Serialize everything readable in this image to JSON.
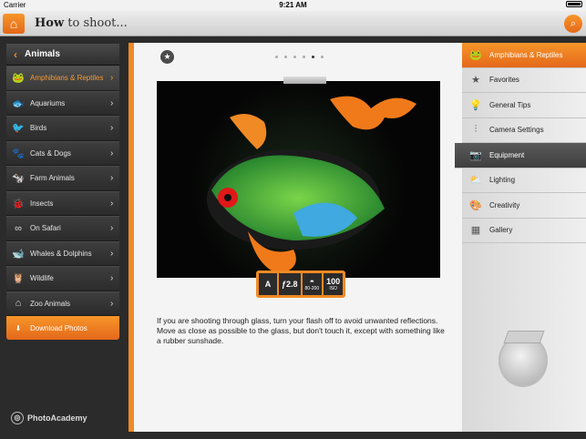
{
  "status_bar": {
    "carrier": "Carrier",
    "time": "9:21 AM",
    "battery_level": 1.0
  },
  "header": {
    "title_bold": "How",
    "title_rest": " to shoot...",
    "home_icon": "home-icon",
    "search_icon": "search-icon"
  },
  "sidebar": {
    "title": "Animals",
    "items": [
      {
        "label": "Amphibians & Reptiles",
        "icon": "frog-icon",
        "active": true
      },
      {
        "label": "Aquariums",
        "icon": "fish-icon"
      },
      {
        "label": "Birds",
        "icon": "bird-icon"
      },
      {
        "label": "Cats & Dogs",
        "icon": "paw-icon"
      },
      {
        "label": "Farm Animals",
        "icon": "cow-icon"
      },
      {
        "label": "Insects",
        "icon": "bug-icon"
      },
      {
        "label": "On Safari",
        "icon": "binoculars-icon"
      },
      {
        "label": "Whales & Dolphins",
        "icon": "whale-icon"
      },
      {
        "label": "Wildlife",
        "icon": "owl-icon"
      },
      {
        "label": "Zoo Animals",
        "icon": "zoo-icon"
      }
    ],
    "download_label": "Download Photos"
  },
  "brand": {
    "name": "PhotoAcademy"
  },
  "content": {
    "page_dots": 6,
    "active_dot": 5,
    "exif": {
      "mode": "A",
      "aperture": "ƒ2.8",
      "iso_range": "80-200",
      "iso": "100",
      "iso_label": "ISO"
    },
    "tip": "If you are shooting through glass, turn your flash off to avoid unwanted reflections. Move as close as possible to the glass, but don't touch it, except with something like a rubber sunshade."
  },
  "rightbar": {
    "items": [
      {
        "label": "Amphibians & Reptiles",
        "icon": "frog-icon",
        "style": "top"
      },
      {
        "label": "Favorites",
        "icon": "star-icon"
      },
      {
        "label": "General Tips",
        "icon": "lightbulb-icon"
      },
      {
        "label": "Camera Settings",
        "icon": "sliders-icon"
      },
      {
        "label": "Equipment",
        "icon": "camera-tripod-icon",
        "style": "sel"
      },
      {
        "label": "Lighting",
        "icon": "cloud-sun-icon"
      },
      {
        "label": "Creativity",
        "icon": "palette-icon"
      },
      {
        "label": "Gallery",
        "icon": "gallery-icon"
      }
    ]
  }
}
